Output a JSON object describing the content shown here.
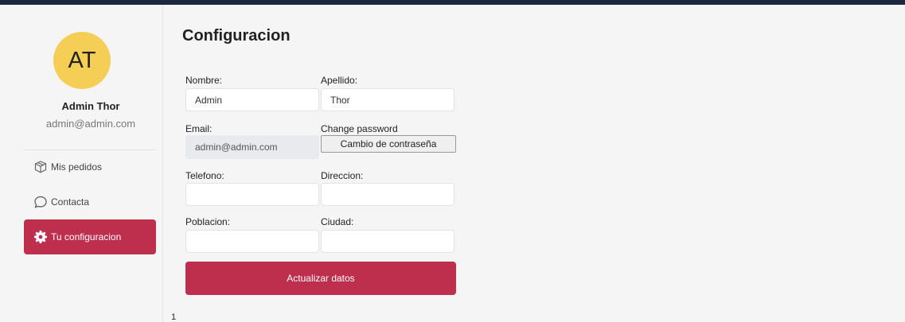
{
  "user": {
    "initials": "AT",
    "name": "Admin Thor",
    "email": "admin@admin.com"
  },
  "sidebar": {
    "items": [
      {
        "label": "Mis pedidos",
        "icon": "package-icon",
        "active": false
      },
      {
        "label": "Contacta",
        "icon": "chat-bubble-icon",
        "active": false
      },
      {
        "label": "Tu configuracion",
        "icon": "gear-icon",
        "active": true
      }
    ]
  },
  "main": {
    "title": "Configuracion",
    "form": {
      "nombre": {
        "label": "Nombre:",
        "value": "Admin"
      },
      "apellido": {
        "label": "Apellido:",
        "value": "Thor"
      },
      "email": {
        "label": "Email:",
        "value": "admin@admin.com"
      },
      "password": {
        "label": "Change password",
        "button": "Cambio de contraseña"
      },
      "telefono": {
        "label": "Telefono:",
        "value": ""
      },
      "direccion": {
        "label": "Direccion:",
        "value": ""
      },
      "poblacion": {
        "label": "Poblacion:",
        "value": ""
      },
      "ciudad": {
        "label": "Ciudad:",
        "value": ""
      },
      "submit": "Actualizar datos"
    },
    "page_number": "1"
  },
  "colors": {
    "accent": "#be2e4d",
    "avatar": "#f5cf55",
    "topbar": "#1e2742"
  }
}
